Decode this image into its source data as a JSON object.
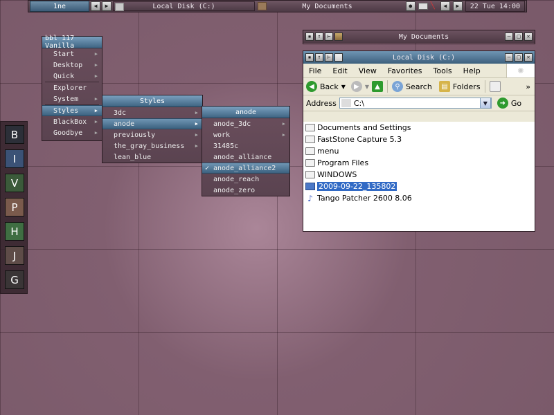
{
  "toolbar": {
    "workspace": "1ne",
    "tasks": [
      {
        "label": "Local Disk (C:)"
      },
      {
        "label": "My Documents"
      }
    ],
    "clock": "22 Tue 14:00"
  },
  "slit": {
    "buttons": [
      {
        "label": "B",
        "color": "#2c2f38"
      },
      {
        "label": "I",
        "color": "#3b5276"
      },
      {
        "label": "V",
        "color": "#3b5a3a"
      },
      {
        "label": "P",
        "color": "#7a5a4c"
      },
      {
        "label": "H",
        "color": "#3f6e42"
      },
      {
        "label": "J",
        "color": "#5e4c48"
      },
      {
        "label": "G",
        "color": "#3a3536"
      }
    ]
  },
  "root_menu": {
    "title": "bbl 117 Vanilla",
    "items": [
      "Start",
      "Desktop",
      "Quick",
      "Explorer",
      "System",
      "Styles",
      "BlackBox",
      "Goodbye"
    ]
  },
  "styles_menu": {
    "title": "Styles",
    "items": [
      "3dc",
      "anode",
      "previously",
      "the_gray_business",
      "lean_blue"
    ]
  },
  "anode_menu": {
    "title": "anode",
    "items": [
      "anode_3dc",
      "work",
      "31485c",
      "anode_alliance",
      "anode_alliance2",
      "anode_reach",
      "anode_zero"
    ],
    "checked_mark": "✓"
  },
  "windows": {
    "my_documents": {
      "title": "My Documents"
    },
    "local_disk": {
      "title": "Local Disk (C:)",
      "menu": [
        "File",
        "Edit",
        "View",
        "Favorites",
        "Tools",
        "Help"
      ],
      "toolbar": {
        "back": "Back",
        "search": "Search",
        "folders": "Folders",
        "more": "»"
      },
      "address": {
        "label": "Address",
        "value": "C:\\",
        "go": "Go"
      },
      "files": [
        {
          "name": "Documents and Settings",
          "icon": "folder"
        },
        {
          "name": "FastStone Capture 5.3",
          "icon": "folder"
        },
        {
          "name": "menu",
          "icon": "folder"
        },
        {
          "name": "Program Files",
          "icon": "folder"
        },
        {
          "name": "WINDOWS",
          "icon": "folder"
        },
        {
          "name": "2009-09-22_135802",
          "icon": "image"
        },
        {
          "name": "Tango Patcher 2600 8.06",
          "icon": "app"
        }
      ]
    }
  }
}
